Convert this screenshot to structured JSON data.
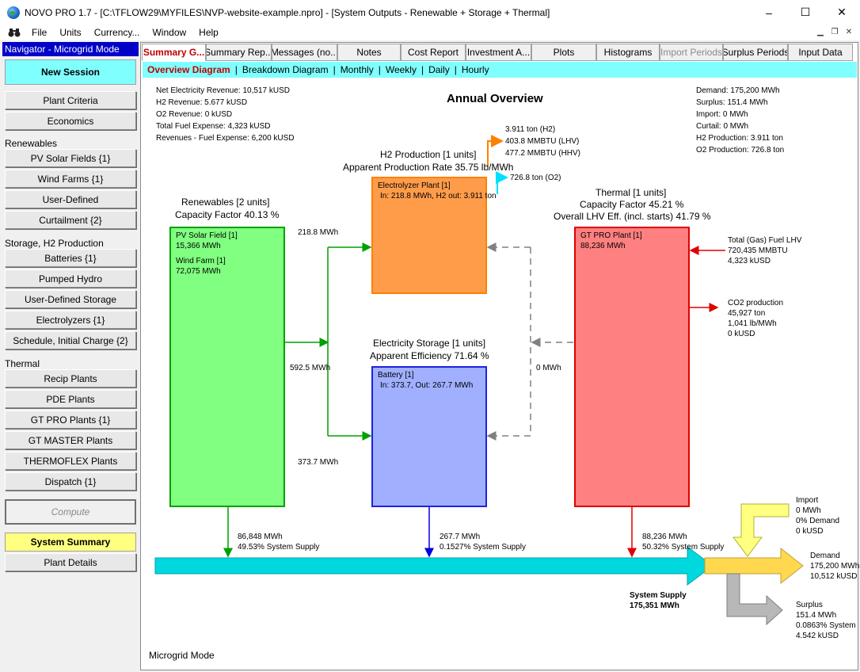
{
  "window": {
    "title": "NOVO PRO 1.7 - [C:\\TFLOW29\\MYFILES\\NVP-website-example.npro] - [System Outputs - Renewable + Storage + Thermal]",
    "min_label": "–",
    "max_label": "☐",
    "close_label": "✕"
  },
  "menu": {
    "items": [
      "File",
      "Units",
      "Currency...",
      "Window",
      "Help"
    ]
  },
  "nav": {
    "header": "Navigator - Microgrid Mode",
    "new_session": "New Session",
    "plant_criteria": "Plant Criteria",
    "economics": "Economics",
    "sec_renewables": "Renewables",
    "pv_solar": "PV Solar Fields {1}",
    "wind_farms": "Wind Farms {1}",
    "user_defined": "User-Defined",
    "curtailment": "Curtailment {2}",
    "sec_storage": "Storage, H2 Production",
    "batteries": "Batteries {1}",
    "pumped_hydro": "Pumped Hydro",
    "user_storage": "User-Defined Storage",
    "electrolyzers": "Electrolyzers {1}",
    "schedule": "Schedule, Initial Charge {2}",
    "sec_thermal": "Thermal",
    "recip": "Recip Plants",
    "pde": "PDE Plants",
    "gtpro": "GT PRO Plants {1}",
    "gtmaster": "GT MASTER Plants",
    "thermoflex": "THERMOFLEX Plants",
    "dispatch": "Dispatch {1}",
    "compute": "Compute",
    "system_summary": "System Summary",
    "plant_details": "Plant Details"
  },
  "tabs": [
    {
      "label": "Summary G..."
    },
    {
      "label": "Summary Rep..."
    },
    {
      "label": "Messages (no..."
    },
    {
      "label": "Notes"
    },
    {
      "label": "Cost Report"
    },
    {
      "label": "Investment A..."
    },
    {
      "label": "Plots"
    },
    {
      "label": "Histograms"
    },
    {
      "label": "Import Periods"
    },
    {
      "label": "Surplus Periods"
    },
    {
      "label": "Input Data"
    }
  ],
  "subtabs": [
    "Overview Diagram",
    "Breakdown Diagram",
    "Monthly",
    "Weekly",
    "Daily",
    "Hourly"
  ],
  "diagram": {
    "title": "Annual Overview",
    "left_summary": [
      "Net Electricity Revenue:  10,517 kUSD",
      "H2 Revenue:  5.677 kUSD",
      "O2 Revenue:  0 kUSD",
      "Total Fuel Expense:  4,323 kUSD",
      "Revenues - Fuel Expense:  6,200 kUSD"
    ],
    "right_summary": [
      "Demand:  175,200 MWh",
      "Surplus:  151.4 MWh",
      "Import:  0 MWh",
      "Curtail:  0 MWh",
      "H2 Production:  3.911 ton",
      "O2 Production:  726.8 ton"
    ],
    "renewables": {
      "title1": "Renewables [2 units]",
      "title2": "Capacity Factor 40.13 %",
      "pv_name": "PV Solar Field [1]",
      "pv_value": "15,366 MWh",
      "wind_name": "Wind Farm [1]",
      "wind_value": "72,075 MWh"
    },
    "h2": {
      "title1": "H2 Production [1 units]",
      "title2": "Apparent Production Rate 35.75 lb/MWh",
      "box_name": "Electrolyzer Plant [1]",
      "box_flow": "In: 218.8 MWh,  H2 out: 3.911 ton",
      "out_h2": "3.911 ton (H2)",
      "out_lhv": "403.8 MMBTU (LHV)",
      "out_hhv": "477.2 MMBTU (HHV)",
      "out_o2": "726.8 ton (O2)"
    },
    "storage": {
      "title1": "Electricity Storage [1 units]",
      "title2": "Apparent Efficiency 71.64 %",
      "box_name": "Battery [1]",
      "box_flow": "In: 373.7,  Out: 267.7 MWh"
    },
    "thermal": {
      "title1": "Thermal [1 units]",
      "title2": "Capacity Factor 45.21 %",
      "title3": "Overall LHV Eff. (incl. starts) 41.79 %",
      "box_name": "GT PRO Plant [1]",
      "box_value": "88,236 MWh",
      "fuel1": "Total (Gas) Fuel LHV",
      "fuel2": "720,435 MMBTU",
      "fuel3": "4,323 kUSD",
      "co2_1": "CO2 production",
      "co2_2": "45,927 ton",
      "co2_3": "1,041 lb/MWh",
      "co2_4": "0 kUSD"
    },
    "flows": {
      "to_h2": "218.8 MWh",
      "renew_total": "592.5 MWh",
      "to_storage": "373.7 MWh",
      "thermal_to_storage": "0 MWh",
      "renew_out1": "86,848 MWh",
      "renew_out2": "49.53% System Supply",
      "storage_out1": "267.7 MWh",
      "storage_out2": "0.1527% System Supply",
      "thermal_out1": "88,236 MWh",
      "thermal_out2": "50.32% System Supply"
    },
    "supply": {
      "label1": "System Supply",
      "label2": "175,351 MWh"
    },
    "import": {
      "l1": "Import",
      "l2": "0 MWh",
      "l3": "0% Demand",
      "l4": "0 kUSD"
    },
    "demand": {
      "l1": "Demand",
      "l2": "175,200 MWh",
      "l3": "10,512 kUSD"
    },
    "surplus": {
      "l1": "Surplus",
      "l2": "151.4 MWh",
      "l3": "0.0863% System",
      "l4": "4.542 kUSD"
    },
    "mode": "Microgrid Mode"
  },
  "colors": {
    "renewables": "#80ff80",
    "h2": "#ff9c4a",
    "storage": "#a0b0ff",
    "thermal": "#ff8080",
    "supply": "#00d8e0",
    "demand": "#ffd850",
    "surplus": "#b8b8b8",
    "import": "#ffff80"
  }
}
